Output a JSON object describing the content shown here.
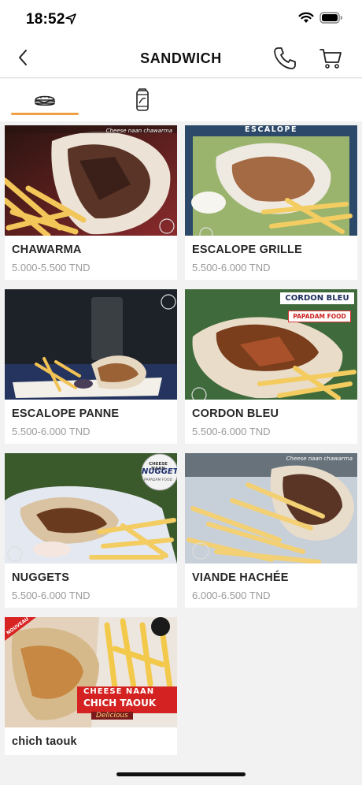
{
  "status_bar": {
    "time": "18:52",
    "icons": [
      "location-arrow-icon",
      "wifi-icon",
      "battery-icon"
    ]
  },
  "header": {
    "title": "SANDWICH",
    "icons": [
      "back-chevron-icon",
      "phone-icon",
      "cart-icon"
    ]
  },
  "tabs": [
    {
      "name": "sandwich",
      "icon": "sandwich-icon",
      "active": true
    },
    {
      "name": "drinks",
      "icon": "soda-can-icon",
      "active": false
    }
  ],
  "colors": {
    "accent": "#f0a042",
    "price": "#9a9a9a",
    "background": "#f2f2f3"
  },
  "products": [
    {
      "name": "CHAWARMA",
      "price": "5.000-5.500 TND",
      "image_text": "Cheese naan chawarma"
    },
    {
      "name": "ESCALOPE GRILLE",
      "price": "5.500-6.000 TND",
      "image_text": "ESCALOPE"
    },
    {
      "name": "ESCALOPE PANNE",
      "price": "5.500-6.000 TND",
      "image_text": ""
    },
    {
      "name": "CORDON BLEU",
      "price": "5.500-6.000 TND",
      "image_text": "CORDON BLEU",
      "image_subtext": "PAPADAM FOOD"
    },
    {
      "name": "NUGGETS",
      "price": "5.500-6.000 TND",
      "image_text": "NUGGETS",
      "image_subtext": "CHEESE NAAN",
      "image_subtext2": "PAPADAM FOOD"
    },
    {
      "name": "VIANDE HACHÉE",
      "price": "6.000-6.500 TND",
      "image_text": "Cheese naan chawarma"
    },
    {
      "name": "chich taouk",
      "price": "",
      "image_text": "CHICH TAOUK",
      "image_subtext": "CHEESE NAAN",
      "image_subtext2": "Delicious",
      "image_corner": "NOUVEAU"
    }
  ]
}
